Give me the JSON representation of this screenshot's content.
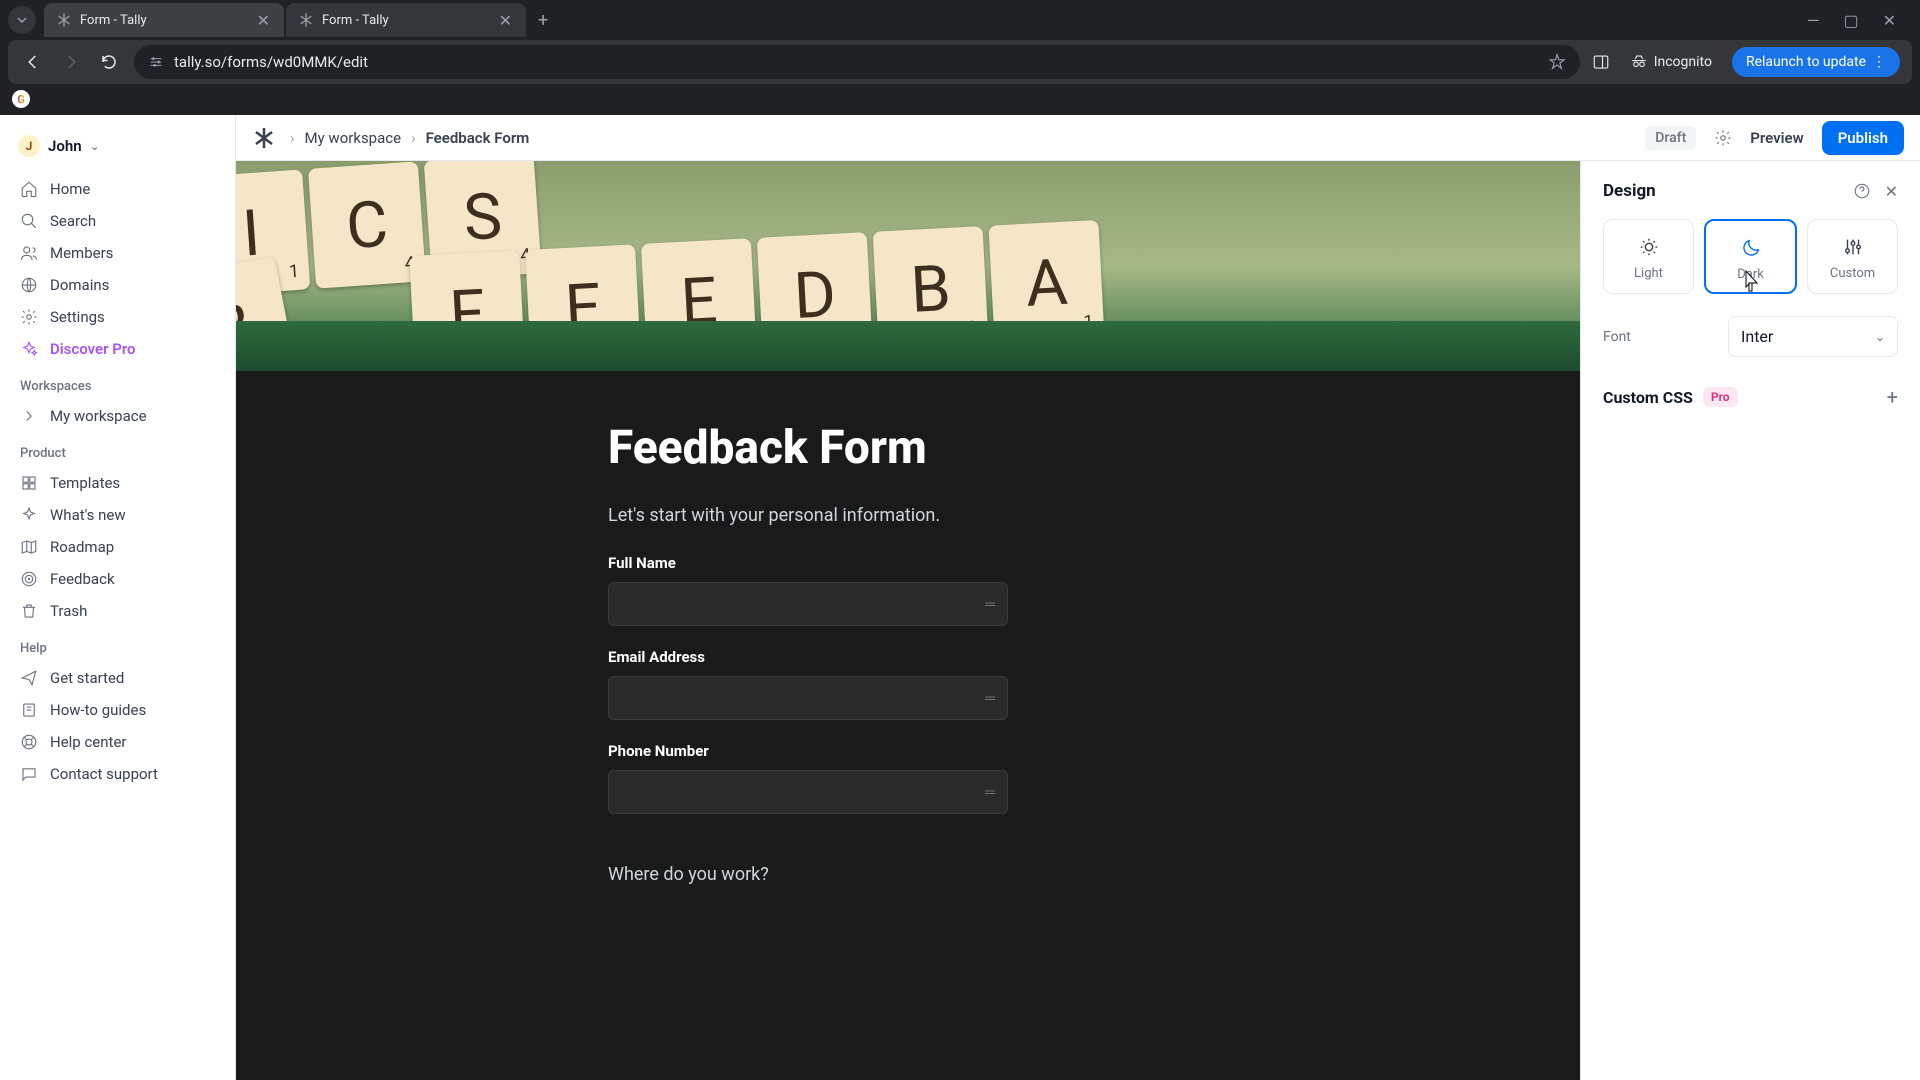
{
  "browser": {
    "tabs": [
      {
        "title": "Form - Tally",
        "active": true
      },
      {
        "title": "Form - Tally",
        "active": false
      }
    ],
    "url": "tally.so/forms/wd0MMK/edit",
    "incognito_label": "Incognito",
    "relaunch_label": "Relaunch to update"
  },
  "sidebar": {
    "user": {
      "initial": "J",
      "name": "John"
    },
    "main_nav": [
      {
        "icon": "home",
        "label": "Home"
      },
      {
        "icon": "search",
        "label": "Search"
      },
      {
        "icon": "members",
        "label": "Members"
      },
      {
        "icon": "globe",
        "label": "Domains"
      },
      {
        "icon": "gear",
        "label": "Settings"
      },
      {
        "icon": "sparkle",
        "label": "Discover Pro",
        "pro": true
      }
    ],
    "workspaces_label": "Workspaces",
    "workspaces": [
      {
        "label": "My workspace"
      }
    ],
    "product_label": "Product",
    "product_nav": [
      {
        "icon": "template",
        "label": "Templates"
      },
      {
        "icon": "sparkle2",
        "label": "What's new"
      },
      {
        "icon": "map",
        "label": "Roadmap"
      },
      {
        "icon": "target",
        "label": "Feedback"
      },
      {
        "icon": "trash",
        "label": "Trash"
      }
    ],
    "help_label": "Help",
    "help_nav": [
      {
        "icon": "send",
        "label": "Get started"
      },
      {
        "icon": "book",
        "label": "How-to guides"
      },
      {
        "icon": "life",
        "label": "Help center"
      },
      {
        "icon": "chat",
        "label": "Contact support"
      }
    ]
  },
  "header": {
    "breadcrumb": [
      "My workspace",
      "Feedback Form"
    ],
    "draft": "Draft",
    "preview": "Preview",
    "publish": "Publish"
  },
  "form": {
    "cover_tiles_r1": [
      "I",
      "C",
      "S"
    ],
    "cover_tiles_r2": [
      "F",
      "E",
      "E",
      "D",
      "B",
      "A"
    ],
    "title": "Feedback Form",
    "intro": "Let's start with your personal information.",
    "fields": [
      {
        "label": "Full Name"
      },
      {
        "label": "Email Address"
      },
      {
        "label": "Phone Number"
      }
    ],
    "question": "Where do you work?"
  },
  "design": {
    "title": "Design",
    "themes": [
      {
        "key": "light",
        "label": "Light"
      },
      {
        "key": "dark",
        "label": "Dark",
        "selected": true
      },
      {
        "key": "custom",
        "label": "Custom"
      }
    ],
    "font_label": "Font",
    "font_value": "Inter",
    "custom_css_label": "Custom CSS",
    "pro_badge": "Pro"
  }
}
